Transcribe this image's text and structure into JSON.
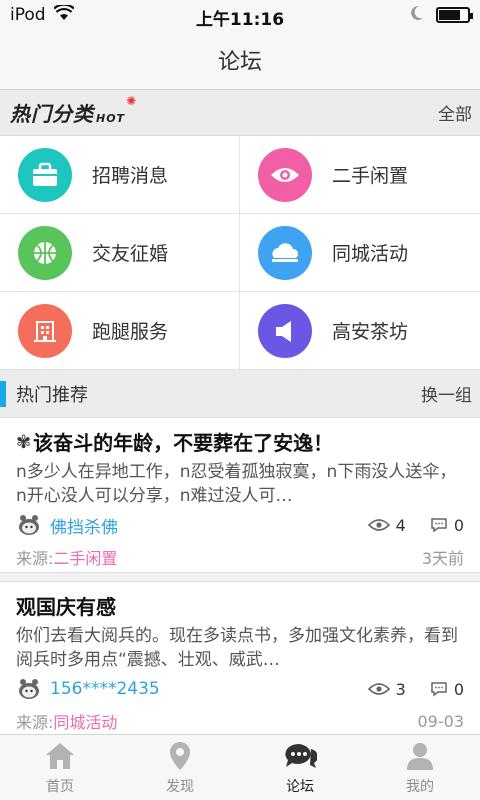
{
  "status_bar": {
    "carrier": "iPod",
    "time": "上午11:16"
  },
  "nav": {
    "title": "论坛"
  },
  "categories": {
    "title": "热门分类",
    "hot": "HOT",
    "all_label": "全部",
    "items": [
      {
        "label": "招聘消息",
        "color": "#1fc6c0",
        "icon": "bag-icon"
      },
      {
        "label": "二手闲置",
        "color": "#f25fa7",
        "icon": "eye-icon"
      },
      {
        "label": "交友征婚",
        "color": "#59c45a",
        "icon": "ball-icon"
      },
      {
        "label": "同城活动",
        "color": "#3fa3f1",
        "icon": "cloud-icon"
      },
      {
        "label": "跑腿服务",
        "color": "#f56d5b",
        "icon": "building-icon"
      },
      {
        "label": "高安茶坊",
        "color": "#6a58e4",
        "icon": "speaker-icon"
      }
    ]
  },
  "recommend": {
    "title": "热门推荐",
    "switch_label": "换一组"
  },
  "posts": [
    {
      "title": "该奋斗的年龄，不要葬在了安逸！",
      "body": "n多少人在异地工作，n忍受着孤独寂寞，n下雨没人送伞，n开心没人可以分享，n难过没人可…",
      "author": "佛挡杀佛",
      "views": "4",
      "comments": "0",
      "source_prefix": "来源:",
      "source": "二手闲置",
      "time": "3天前"
    },
    {
      "title": "观国庆有感",
      "body": "你们去看大阅兵的。现在多读点书，多加强文化素养，看到阅兵时多用点“震撼、壮观、威武…",
      "author": "156****2435",
      "views": "3",
      "comments": "0",
      "source_prefix": "来源:",
      "source": "同城活动",
      "time": "09-03"
    }
  ],
  "tabs": [
    {
      "label": "首页",
      "icon": "home-icon"
    },
    {
      "label": "发现",
      "icon": "location-icon"
    },
    {
      "label": "论坛",
      "icon": "chat-icon"
    },
    {
      "label": "我的",
      "icon": "person-icon"
    }
  ],
  "active_tab": "论坛"
}
